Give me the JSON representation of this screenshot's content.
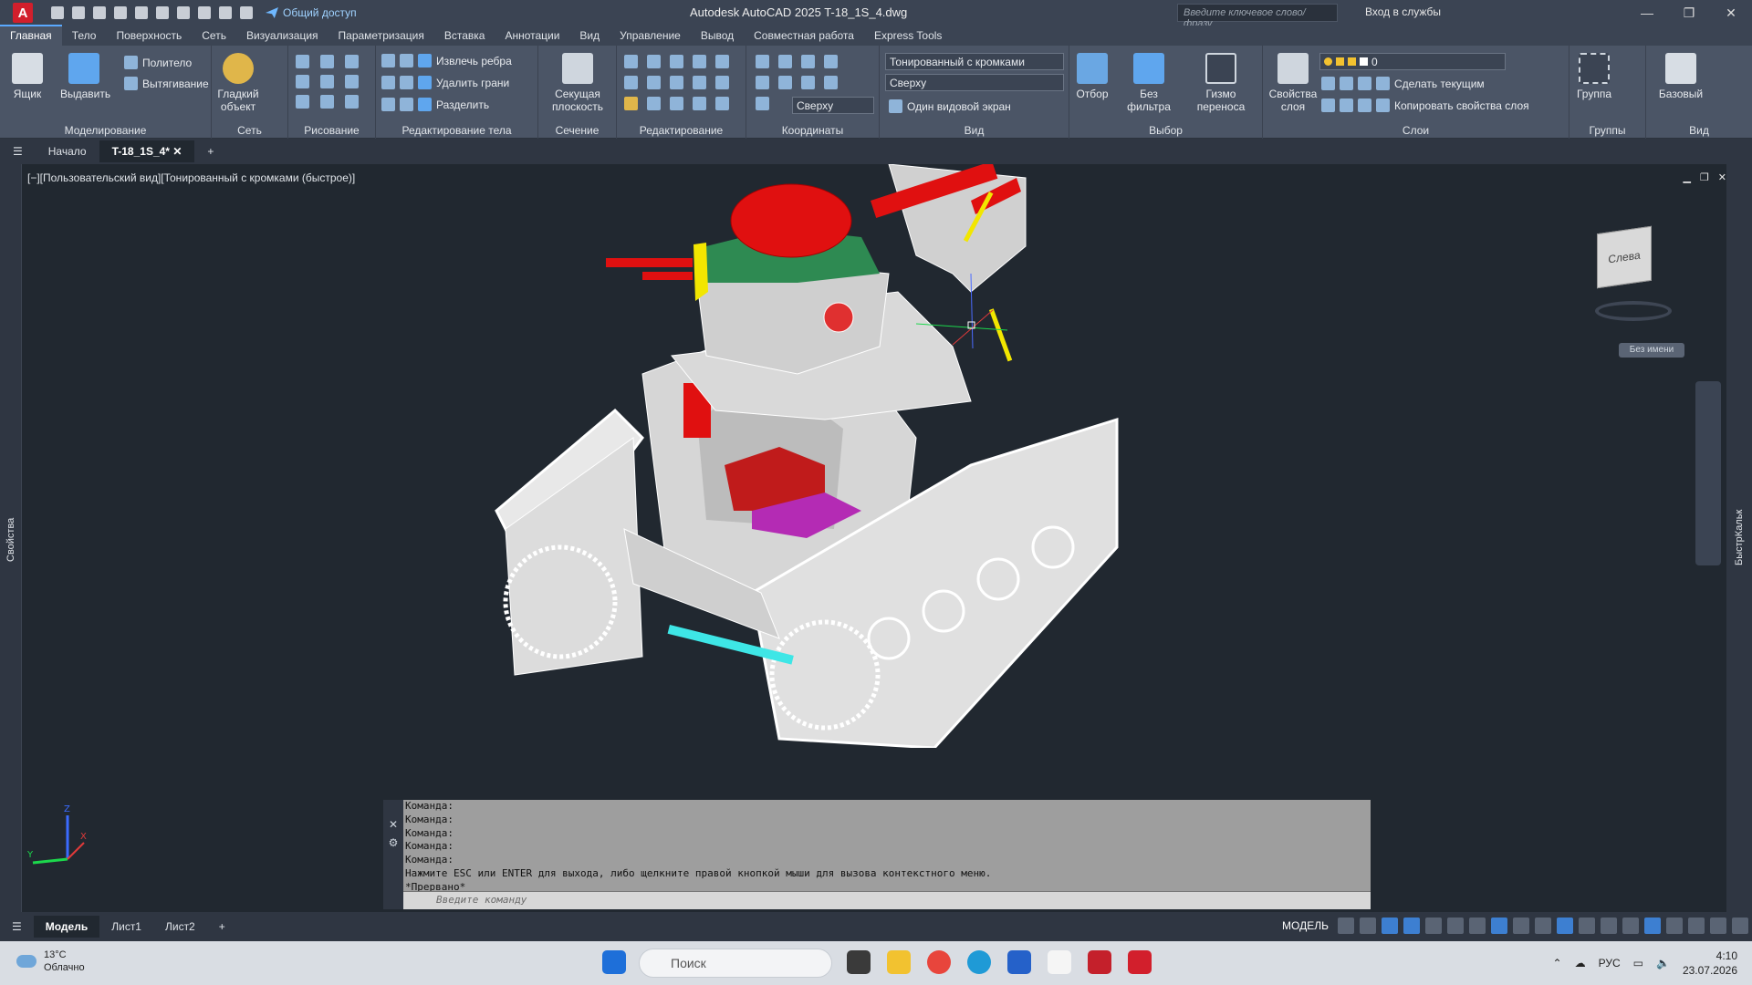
{
  "app": {
    "logo": "A",
    "title": "Autodesk AutoCAD 2025    T-18_1S_4.dwg",
    "share_label": "Общий доступ",
    "search_placeholder": "Введите ключевое слово/фразу",
    "signin_label": "Вход в службы"
  },
  "ribbon_tabs": [
    "Главная",
    "Тело",
    "Поверхность",
    "Сеть",
    "Визуализация",
    "Параметризация",
    "Вставка",
    "Аннотации",
    "Вид",
    "Управление",
    "Вывод",
    "Совместная работа",
    "Express Tools"
  ],
  "ribbon": {
    "modeling": {
      "title": "Моделирование",
      "box": "Ящик",
      "extrude": "Выдавить",
      "polysolid": "Политело",
      "presspull": "Вытягивание"
    },
    "mesh": {
      "title": "Сеть",
      "smooth": "Гладкий объект"
    },
    "draw": {
      "title": "Рисование"
    },
    "solid_edit": {
      "title": "Редактирование тела",
      "extract_edges": "Извлечь ребра",
      "delete_faces": "Удалить грани",
      "separate": "Разделить"
    },
    "section": {
      "title": "Сечение",
      "plane": "Секущая плоскость"
    },
    "modify": {
      "title": "Редактирование"
    },
    "coords": {
      "title": "Координаты",
      "ucs_view": "Сверху"
    },
    "view": {
      "title": "Вид",
      "visual_style": "Тонированный с кромками",
      "view_preset": "Сверху",
      "viewport_config": "Один видовой экран"
    },
    "selection": {
      "title": "Выбор",
      "culling": "Отбор",
      "no_filter": "Без фильтра",
      "gizmo": "Гизмо переноса"
    },
    "layers": {
      "title": "Слои",
      "props": "Свойства слоя",
      "layer_name": "0",
      "make_current": "Сделать текущим",
      "copy_props": "Копировать свойства слоя"
    },
    "groups": {
      "title": "Группы",
      "group": "Группа"
    },
    "view2": {
      "title": "Вид",
      "base": "Базовый"
    }
  },
  "doc_tabs": {
    "start": "Начало",
    "active": "T-18_1S_4*"
  },
  "viewport": {
    "label": "[−][Пользовательский вид][Тонированный с кромками (быстрое)]",
    "viewcube_face": "Слева",
    "ucs_name": "Без имени"
  },
  "sidebar": {
    "left": "Свойства",
    "right": "БыстрКальк"
  },
  "command": {
    "lines": [
      "Команда:",
      "Команда:",
      "Команда:",
      "Команда:",
      "Команда:",
      "Нажмите ESC или ENTER для выхода, либо щелкните правой кнопкой мыши для вызова контекстного меню.",
      "*Прервано*"
    ],
    "placeholder": "Введите команду"
  },
  "layout_tabs": [
    "Модель",
    "Лист1",
    "Лист2"
  ],
  "status": {
    "mode": "МОДЕЛЬ"
  },
  "taskbar": {
    "temp": "13°C",
    "condition": "Облачно",
    "search": "Поиск",
    "lang": "РУС",
    "time": "4:10",
    "date": "23.07.2026"
  }
}
